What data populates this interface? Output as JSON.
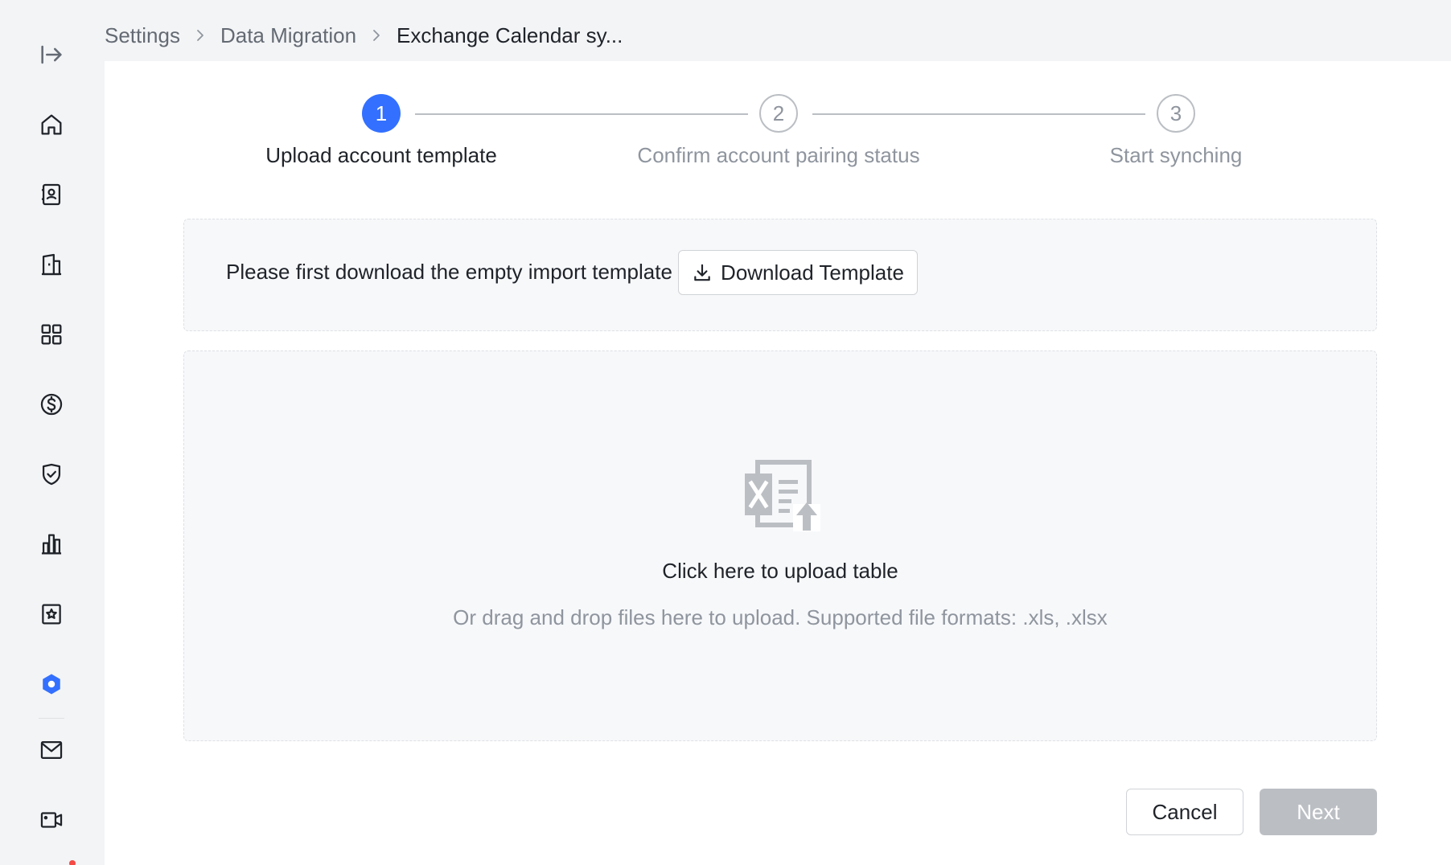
{
  "breadcrumb": {
    "items": [
      "Settings",
      "Data Migration",
      "Exchange Calendar sy..."
    ]
  },
  "steps": [
    {
      "number": "1",
      "label": "Upload account template",
      "state": "active"
    },
    {
      "number": "2",
      "label": "Confirm account pairing status",
      "state": "inactive"
    },
    {
      "number": "3",
      "label": "Start synching",
      "state": "inactive"
    }
  ],
  "download": {
    "prompt": "Please first download the empty import template",
    "button_label": "Download Template"
  },
  "upload": {
    "title": "Click here to upload table",
    "hint": "Or drag and drop files here to upload. Supported file formats: .xls, .xlsx"
  },
  "footer": {
    "cancel_label": "Cancel",
    "next_label": "Next"
  },
  "sidebar": {
    "icons": [
      "expand-icon",
      "home-icon",
      "contacts-icon",
      "organization-icon",
      "apps-icon",
      "billing-icon",
      "security-icon",
      "analytics-icon",
      "badge-icon",
      "settings-icon",
      "mail-icon",
      "video-icon"
    ]
  },
  "colors": {
    "accent": "#3370ff",
    "disabled": "#bbbfc4",
    "muted_text": "#8f959e"
  }
}
